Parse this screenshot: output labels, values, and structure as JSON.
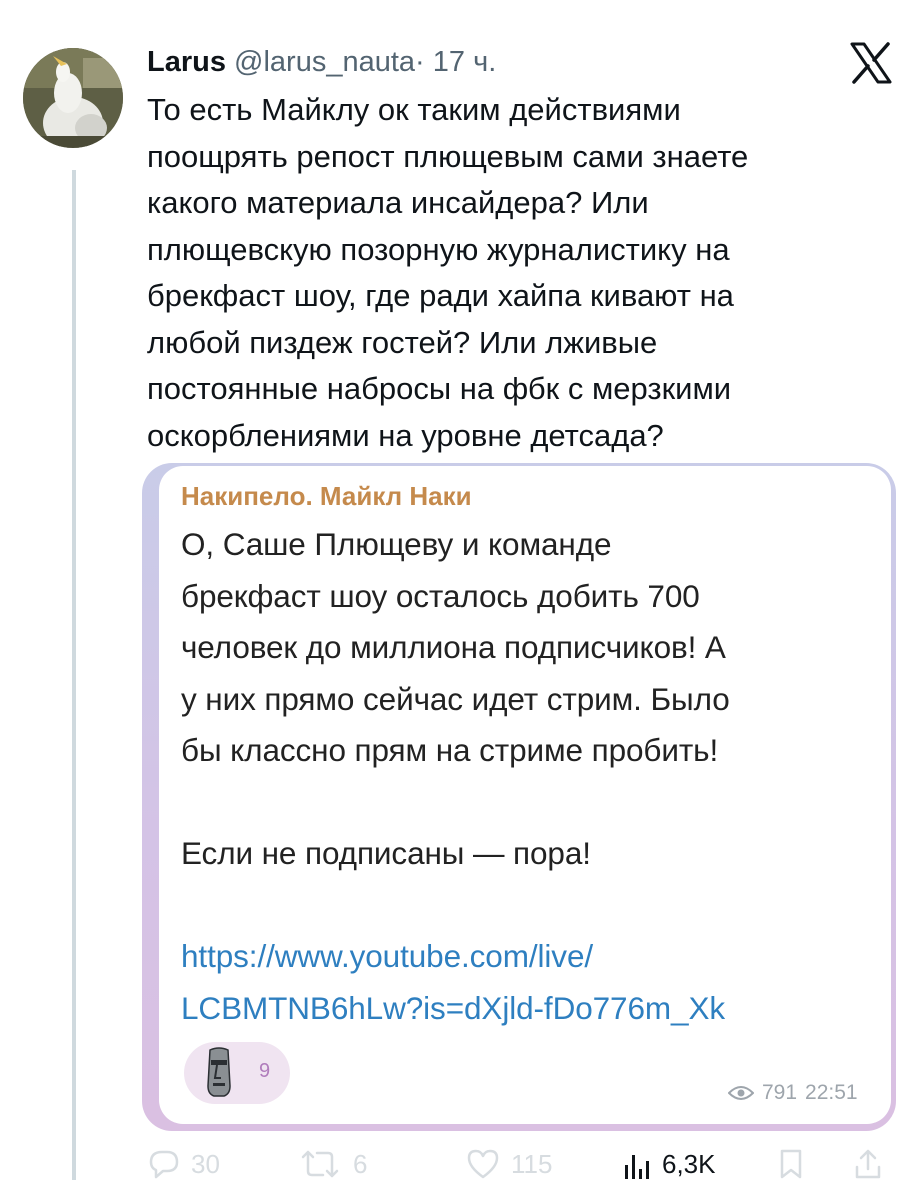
{
  "tweet": {
    "author_name": "Larus",
    "author_handle": "@larus_nauta",
    "separator": "·",
    "time_ago": "17 ч.",
    "text_lines": [
      "То есть Майклу ок таким действиями",
      "поощрять репост плющевым сами знаете",
      "какого материала инсайдера? Или",
      "плющевскую позорную журналистику на",
      "брекфаст шоу, где ради хайпа кивают на",
      "любой пиздеж гостей? Или лживые",
      "постоянные набросы на фбк с мерзкими",
      "оскорблениями на уровне детсада?"
    ]
  },
  "quoted_post": {
    "channel_name": "Накипело. Майкл Наки",
    "body_lines": [
      "О, Саше Плющеву и команде",
      "брекфаст шоу осталось добить 700",
      "человек до миллиона подписчиков! А",
      "у них прямо сейчас идет стрим. Было",
      "бы классно прям на стриме пробить!"
    ],
    "call_to_action": "Если не подписаны — пора!",
    "link_lines": [
      "https://www.youtube.com/live/",
      "LCBMTNB6hLw?is=dXjld-fDo776m_Xk"
    ],
    "reaction_icon": "moai-emoji",
    "reaction_count": "9",
    "views": "791",
    "time": "22:51",
    "accent_color": "#c58a4c",
    "link_color": "#2e7fc0"
  },
  "actions": {
    "reply_count": "30",
    "retweet_count": "6",
    "like_count": "115",
    "views_count": "6,3K"
  }
}
